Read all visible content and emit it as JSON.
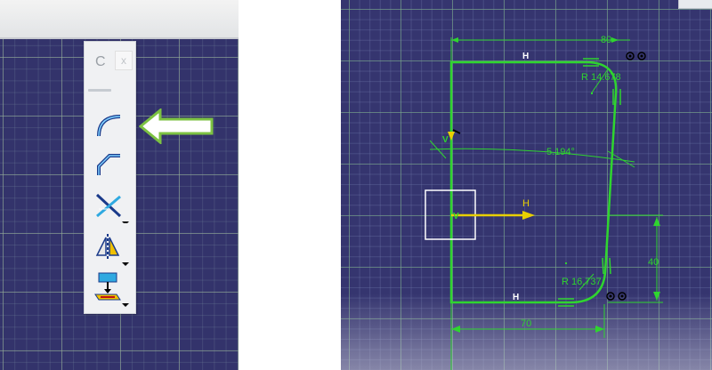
{
  "toolbar": {
    "title_fragment": "C",
    "close_symbol": "x",
    "tools": [
      {
        "name": "corner"
      },
      {
        "name": "chamfer"
      },
      {
        "name": "trim"
      },
      {
        "name": "mirror"
      },
      {
        "name": "project-3d-elements"
      }
    ]
  },
  "sketch": {
    "dimensions": {
      "top_length": "80",
      "radius_top": "R 14.678",
      "angle": "5.194°",
      "right_height": "40",
      "radius_bottom": "R 16.737",
      "bottom_length": "70"
    },
    "constraint_labels": {
      "horizontal_top": "H",
      "horizontal_bottom": "H",
      "axis_h": "H",
      "axis_v": "V",
      "vertical_marker": "V"
    }
  },
  "colors": {
    "sketch_green": "#2fd52f",
    "axis_yellow": "#e8d000",
    "background": "#35356f"
  }
}
